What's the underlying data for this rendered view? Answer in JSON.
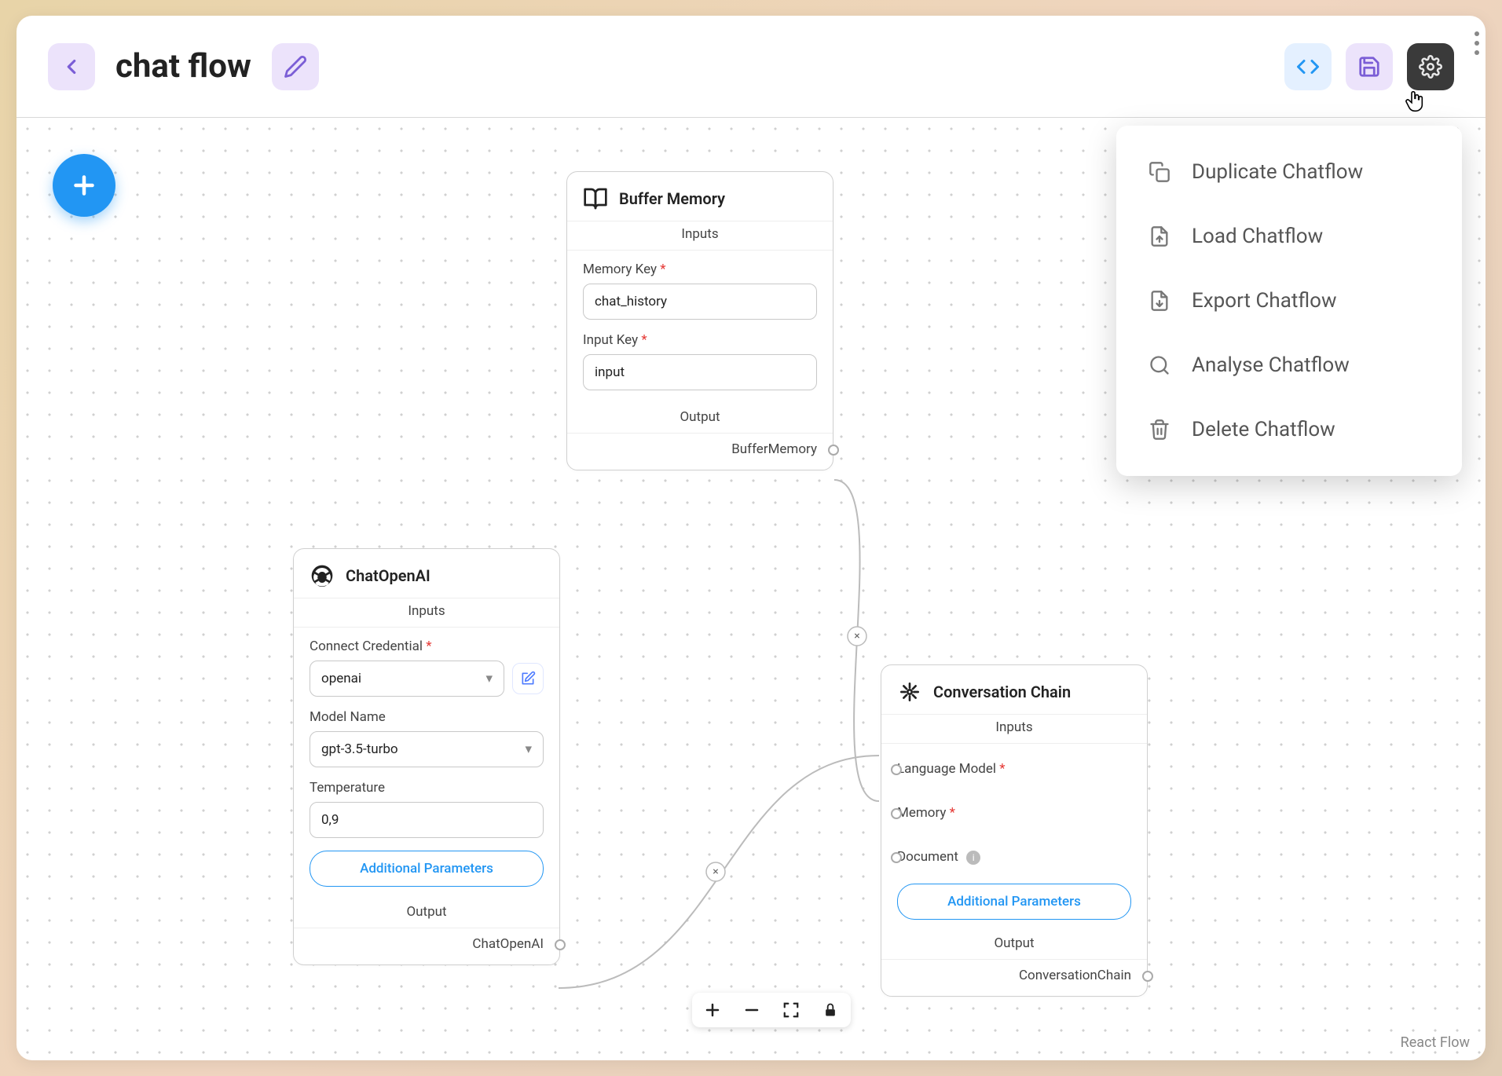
{
  "header": {
    "title": "chat flow"
  },
  "dropdown": {
    "items": [
      {
        "label": "Duplicate Chatflow",
        "icon": "copy"
      },
      {
        "label": "Load Chatflow",
        "icon": "upload"
      },
      {
        "label": "Export Chatflow",
        "icon": "download"
      },
      {
        "label": "Analyse Chatflow",
        "icon": "search"
      },
      {
        "label": "Delete Chatflow",
        "icon": "trash"
      }
    ]
  },
  "nodes": {
    "bufferMemory": {
      "title": "Buffer Memory",
      "inputs_label": "Inputs",
      "output_label": "Output",
      "memory_key_label": "Memory Key",
      "memory_key_value": "chat_history",
      "input_key_label": "Input Key",
      "input_key_value": "input",
      "output_name": "BufferMemory"
    },
    "chatOpenAI": {
      "title": "ChatOpenAI",
      "inputs_label": "Inputs",
      "output_label": "Output",
      "cred_label": "Connect Credential",
      "cred_value": "openai",
      "model_label": "Model Name",
      "model_value": "gpt-3.5-turbo",
      "temp_label": "Temperature",
      "temp_value": "0,9",
      "addl_label": "Additional Parameters",
      "output_name": "ChatOpenAI"
    },
    "conversationChain": {
      "title": "Conversation Chain",
      "inputs_label": "Inputs",
      "output_label": "Output",
      "lang_model_label": "Language Model",
      "memory_label": "Memory",
      "document_label": "Document",
      "addl_label": "Additional Parameters",
      "output_name": "ConversationChain"
    }
  },
  "attribution": "React Flow"
}
